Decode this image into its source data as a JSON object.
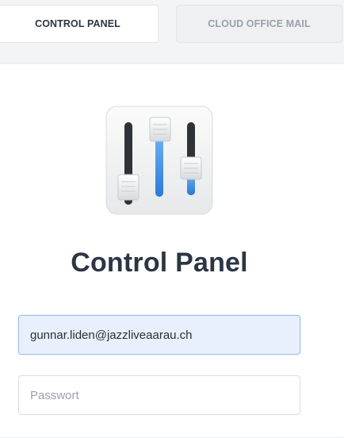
{
  "tabs": [
    {
      "label": "CONTROL PANEL",
      "active": true
    },
    {
      "label": "CLOUD OFFICE MAIL",
      "active": false
    }
  ],
  "login": {
    "icon": "mixer-sliders-icon",
    "title": "Control Panel",
    "email_value": "gunnar.liden@jazzliveaarau.ch",
    "password_placeholder": "Passwort"
  },
  "colors": {
    "title": "#2c3543",
    "slider_accent": "#3b8de0",
    "email_field_bg": "#e9f0fd",
    "email_field_border": "#9fc0ea",
    "page_bg": "#f3f4f6"
  }
}
